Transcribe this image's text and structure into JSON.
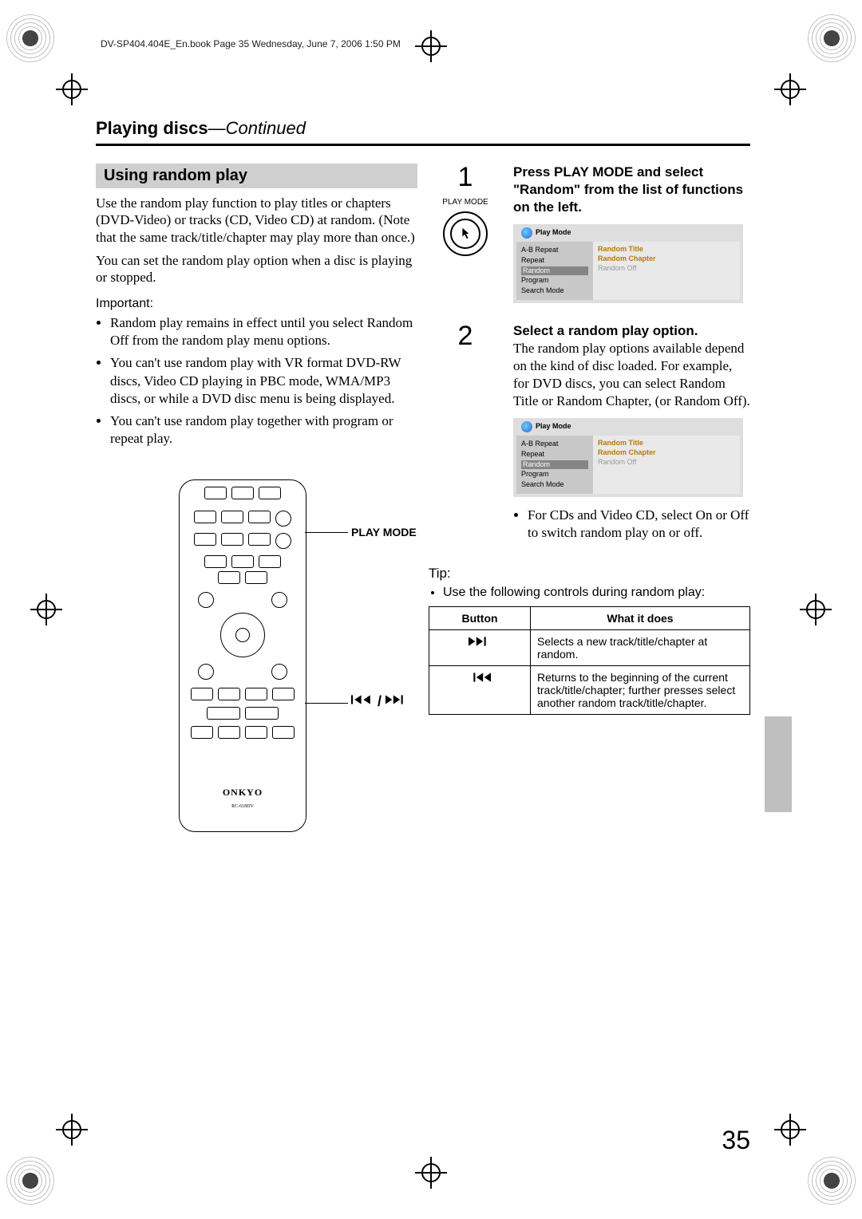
{
  "running_head": "DV-SP404.404E_En.book  Page 35  Wednesday, June 7, 2006  1:50 PM",
  "breadcrumb_title": "Playing discs",
  "breadcrumb_continued": "—Continued",
  "section_heading": "Using random play",
  "intro_text": "Use the random play function to play titles or chapters (DVD-Video) or tracks (CD, Video CD) at random. (Note that the same track/title/chapter may play more than once.)",
  "intro_text2": "You can set the random play option when a disc is playing or stopped.",
  "important_label": "Important:",
  "important_items": [
    "Random play remains in effect until you select Random Off from the random play menu options.",
    "You can't use random play with VR format DVD-RW discs, Video CD playing in PBC mode, WMA/MP3 discs, or while a DVD disc menu is being displayed.",
    "You can't use random play together with program or repeat play."
  ],
  "remote": {
    "brand": "ONKYO",
    "model": "RC-618DV",
    "callout_playmode": "PLAY MODE",
    "callout_transport": "⏮ / ⏭"
  },
  "steps": [
    {
      "num": "1",
      "icon_label": "PLAY MODE",
      "title": "Press PLAY MODE and select \"Random\" from the list of functions on the left.",
      "body": "",
      "osd": {
        "title": "Play Mode",
        "left": [
          "A-B Repeat",
          "Repeat",
          "Random",
          "Program",
          "Search Mode"
        ],
        "selected": "Random",
        "right": [
          {
            "text": "Random Title",
            "style": "hot"
          },
          {
            "text": "Random Chapter",
            "style": "hot"
          },
          {
            "text": "Random Off",
            "style": "muted"
          }
        ]
      }
    },
    {
      "num": "2",
      "icon_label": "",
      "title": "Select a random play option.",
      "body": "The random play options available depend on the kind of disc loaded. For example, for DVD discs, you can select Random Title or Random Chapter, (or Random Off).",
      "osd": {
        "title": "Play Mode",
        "left": [
          "A-B Repeat",
          "Repeat",
          "Random",
          "Program",
          "Search Mode"
        ],
        "selected": "Random",
        "right": [
          {
            "text": "Random Title",
            "style": "hot"
          },
          {
            "text": "Random Chapter",
            "style": "hot"
          },
          {
            "text": "Random Off",
            "style": "muted"
          }
        ]
      },
      "extra_bullet": "For CDs and Video CD, select On or Off to switch random play on or off."
    }
  ],
  "tip_label": "Tip:",
  "tip_intro": "Use the following controls during random play:",
  "controls_table": {
    "headers": [
      "Button",
      "What it does"
    ],
    "rows": [
      {
        "icon": "next",
        "desc": "Selects a new track/title/chapter at random."
      },
      {
        "icon": "prev",
        "desc": "Returns to the beginning of the current track/title/chapter; further presses select another random track/title/chapter."
      }
    ]
  },
  "page_number": "35"
}
